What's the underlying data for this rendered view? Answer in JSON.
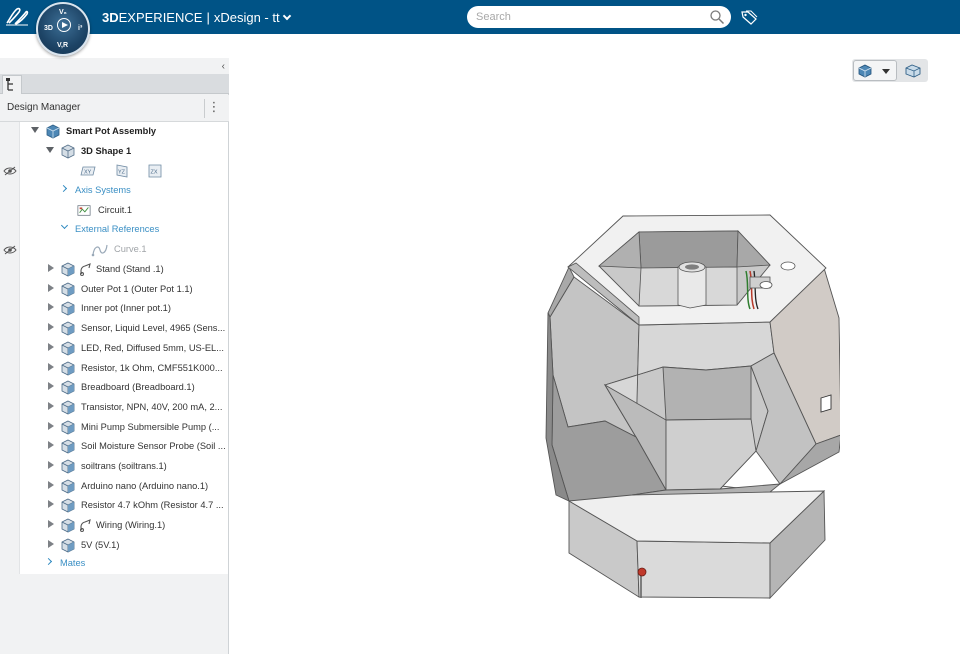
{
  "header": {
    "brand_bold": "3D",
    "brand_rest": "EXPERIENCE",
    "separator": "|",
    "app_name": "xDesign - tt",
    "search_placeholder": "Search",
    "compass": {
      "top": "V₆",
      "left": "3D",
      "right": "i³",
      "bottom": "V,R"
    }
  },
  "panel": {
    "collapse_label": "‹",
    "title": "Design Manager",
    "menu_label": "⋮"
  },
  "tree": {
    "root": "Smart Pot Assembly",
    "shape": "3D Shape 1",
    "planes": [
      "XY",
      "YZ",
      "ZX"
    ],
    "axis_systems": "Axis Systems",
    "circuit": "Circuit.1",
    "external_references": "External References",
    "curve": "Curve.1",
    "items": [
      "Stand  (Stand .1)",
      "Outer Pot 1 (Outer Pot 1.1)",
      "Inner pot (Inner pot.1)",
      "Sensor, Liquid Level, 4965 (Sens...",
      "LED, Red, Diffused 5mm, US-EL...",
      "Resistor, 1k Ohm, CMF551K000...",
      "Breadboard (Breadboard.1)",
      "Transistor, NPN, 40V, 200 mA, 2...",
      "Mini Pump Submersible Pump (...",
      "Soil Moisture Sensor Probe (Soil ...",
      "soiltrans (soiltrans.1)",
      "Arduino nano (Arduino nano.1)",
      "Resistor 4.7 kOhm (Resistor 4.7 ...",
      "Wiring (Wiring.1)",
      "5V (5V.1)"
    ],
    "mates": "Mates"
  },
  "colors": {
    "topbar": "#005386",
    "link": "#3a8fc4",
    "model_light": "#dcdcdc",
    "model_mid": "#b7b7b7",
    "model_dark": "#8e8e8e"
  }
}
